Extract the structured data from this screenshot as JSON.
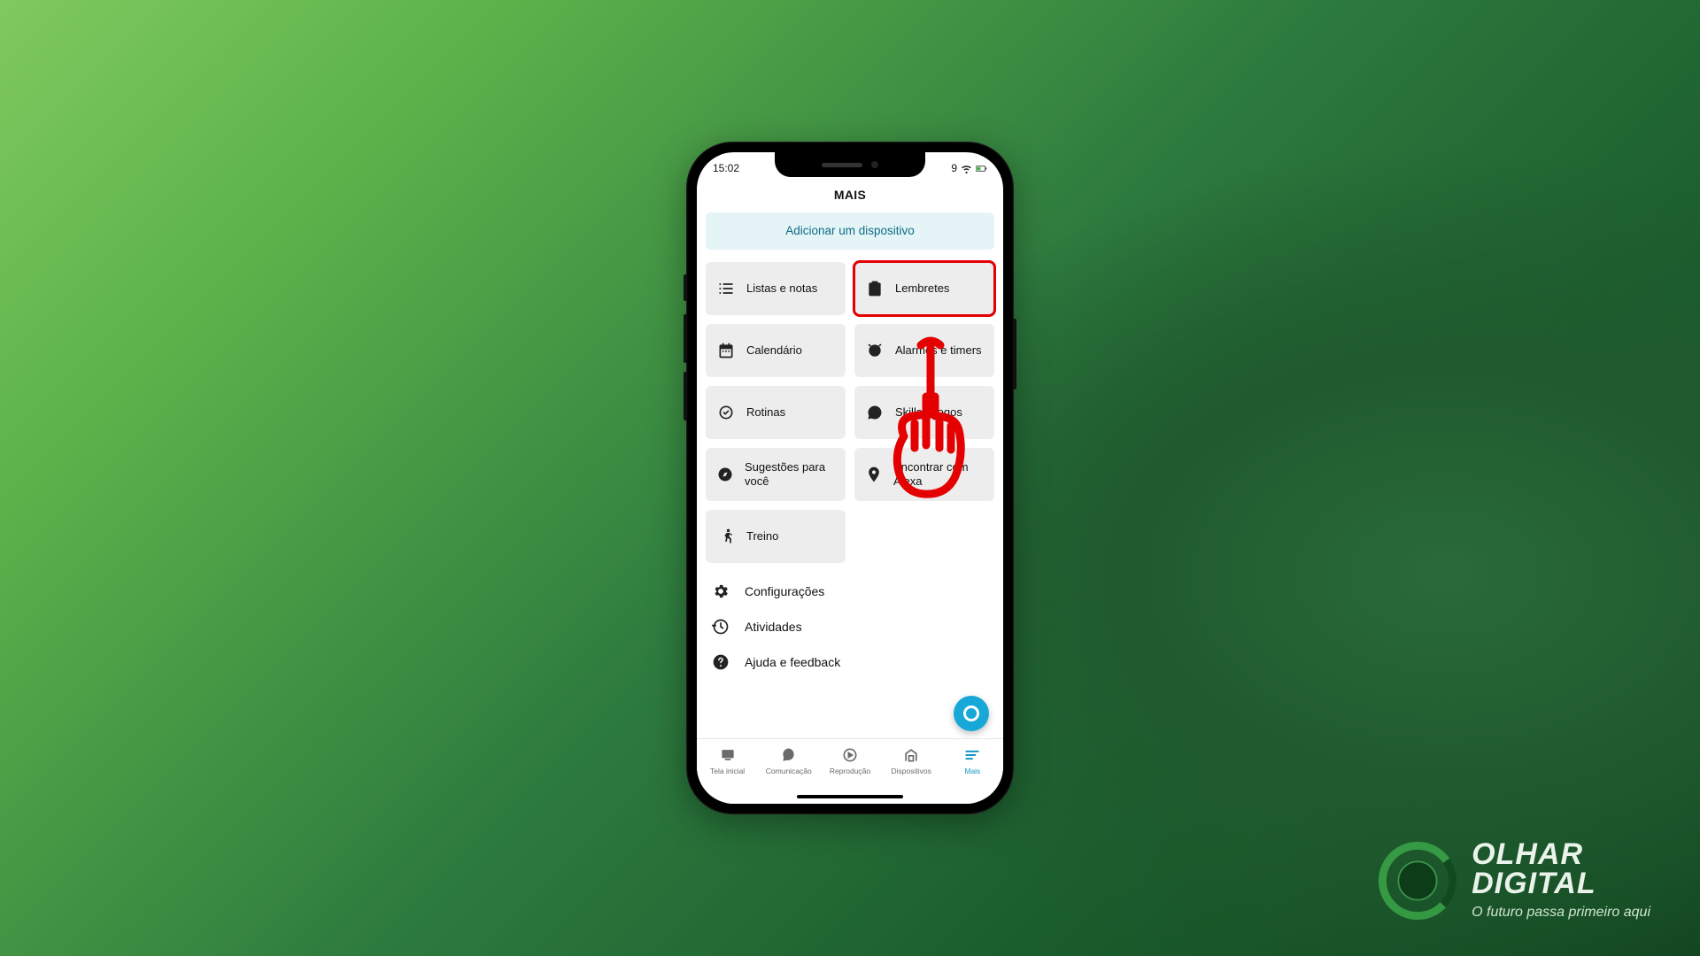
{
  "statusbar": {
    "time": "15:02",
    "signal_num": "9"
  },
  "app": {
    "title": "MAIS"
  },
  "add_device": {
    "label": "Adicionar um dispositivo"
  },
  "tiles": [
    {
      "id": "listas-notas",
      "label": "Listas e notas"
    },
    {
      "id": "lembretes",
      "label": "Lembretes",
      "highlight": true
    },
    {
      "id": "calendario",
      "label": "Calendário"
    },
    {
      "id": "alarmes",
      "label": "Alarmes e timers"
    },
    {
      "id": "rotinas",
      "label": "Rotinas"
    },
    {
      "id": "skills",
      "label": "Skills e jogos"
    },
    {
      "id": "sugestoes",
      "label": "Sugestões para você"
    },
    {
      "id": "encontrar",
      "label": "Encontrar com Alexa"
    },
    {
      "id": "treino",
      "label": "Treino"
    }
  ],
  "rows": {
    "config": {
      "label": "Configurações"
    },
    "atividades": {
      "label": "Atividades"
    },
    "ajuda": {
      "label": "Ajuda e feedback"
    }
  },
  "nav": {
    "home": "Tela inicial",
    "comm": "Comunicação",
    "play": "Reprodução",
    "devices": "Dispositivos",
    "mais": "Mais"
  },
  "watermark": {
    "line1": "OLHAR",
    "line2": "DIGITAL",
    "tagline": "O futuro passa primeiro aqui"
  }
}
